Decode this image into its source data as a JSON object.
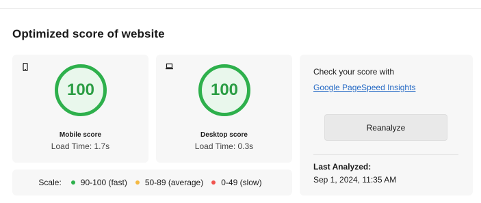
{
  "section_title": "Optimized score of website",
  "mobile": {
    "icon": "mobile-phone-icon",
    "score": "100",
    "label": "Mobile score",
    "load_time": "Load Time: 1.7s"
  },
  "desktop": {
    "icon": "laptop-icon",
    "score": "100",
    "label": "Desktop score",
    "load_time": "Load Time: 0.3s"
  },
  "side_panel": {
    "check_text": "Check your score with",
    "link_text": "Google PageSpeed Insights",
    "button_label": "Reanalyze",
    "last_analyzed_label": "Last Analyzed:",
    "last_analyzed_value": "Sep 1, 2024, 11:35 AM"
  },
  "scale": {
    "label": "Scale:",
    "items": [
      {
        "text": "90-100 (fast)",
        "color": "#2eb04c"
      },
      {
        "text": "50-89 (average)",
        "color": "#f4b942"
      },
      {
        "text": "0-49 (slow)",
        "color": "#f0534e"
      }
    ]
  },
  "colors": {
    "gauge_ring": "#2eb04c",
    "gauge_fill": "#e9f7ec",
    "gauge_text": "#2b9d44",
    "link": "#2368c4"
  }
}
